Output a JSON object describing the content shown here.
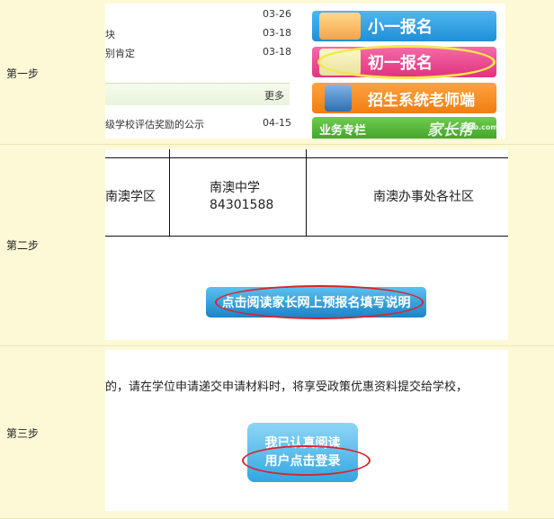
{
  "steps": [
    {
      "label": "第一步"
    },
    {
      "label": "第二步"
    },
    {
      "label": "第三步"
    }
  ],
  "step1": {
    "news": [
      {
        "title": "",
        "date": "03-26"
      },
      {
        "title": "块",
        "date": "03-18"
      },
      {
        "title": "别肯定",
        "date": "03-18"
      }
    ],
    "more_label": "更多",
    "news2": [
      {
        "title": "级学校评估奖励的公示",
        "date": "04-15"
      }
    ],
    "buttons": {
      "primary_label": "小一报名",
      "junior_label": "初一报名",
      "teacher_label": "招生系统老师端",
      "business_label": "业务专栏",
      "watermark": "家长帮",
      "watermark_url": "jzb.com"
    }
  },
  "step2": {
    "table": {
      "cell_district": "南澳学区",
      "school_name": "南澳中学",
      "school_phone": "84301588",
      "cell_area": "南澳办事处各社区"
    },
    "read_button_label": "点击阅读家长网上预报名填写说明"
  },
  "step3": {
    "notice_text": "的，请在学位申请递交申请材料时，将享受政策优惠资料提交给学校，",
    "confirm_line1": "我已认真阅读",
    "confirm_line2": "用户点击登录"
  },
  "colors": {
    "page_bg": "#fdf9d6",
    "accent_red": "#d9242c",
    "highlight_yellow": "#f3e84a"
  }
}
